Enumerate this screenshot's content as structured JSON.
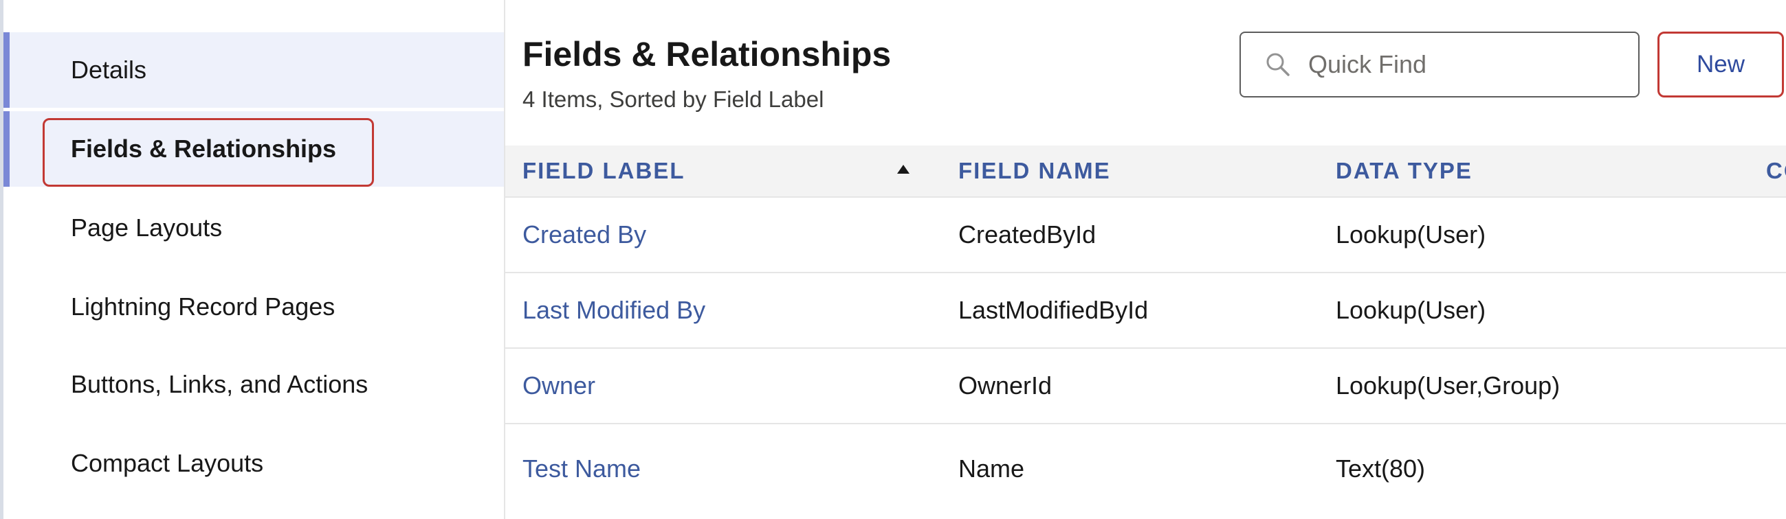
{
  "sidebar": {
    "items": [
      {
        "label": "Details"
      },
      {
        "label": "Fields & Relationships"
      },
      {
        "label": "Page Layouts"
      },
      {
        "label": "Lightning Record Pages"
      },
      {
        "label": "Buttons, Links, and Actions"
      },
      {
        "label": "Compact Layouts"
      }
    ]
  },
  "header": {
    "title": "Fields & Relationships",
    "subtitle": "4 Items, Sorted by Field Label",
    "search_placeholder": "Quick Find",
    "new_label": "New"
  },
  "table": {
    "columns": [
      "FIELD LABEL",
      "FIELD NAME",
      "DATA TYPE",
      "CO"
    ],
    "sort_column": "FIELD LABEL",
    "rows": [
      {
        "label": "Created By",
        "name": "CreatedById",
        "type": "Lookup(User)"
      },
      {
        "label": "Last Modified By",
        "name": "LastModifiedById",
        "type": "Lookup(User)"
      },
      {
        "label": "Owner",
        "name": "OwnerId",
        "type": "Lookup(User,Group)"
      },
      {
        "label": "Test Name",
        "name": "Name",
        "type": "Text(80)"
      }
    ]
  },
  "colors": {
    "accent": "#7a88d6",
    "link": "#3d5a9e",
    "highlight": "#c23934",
    "sidebar_selected_bg": "#eef1fb",
    "header_bg": "#f3f3f3"
  },
  "icons": {
    "search": "search-icon",
    "sort": "sort-ascending-icon"
  }
}
